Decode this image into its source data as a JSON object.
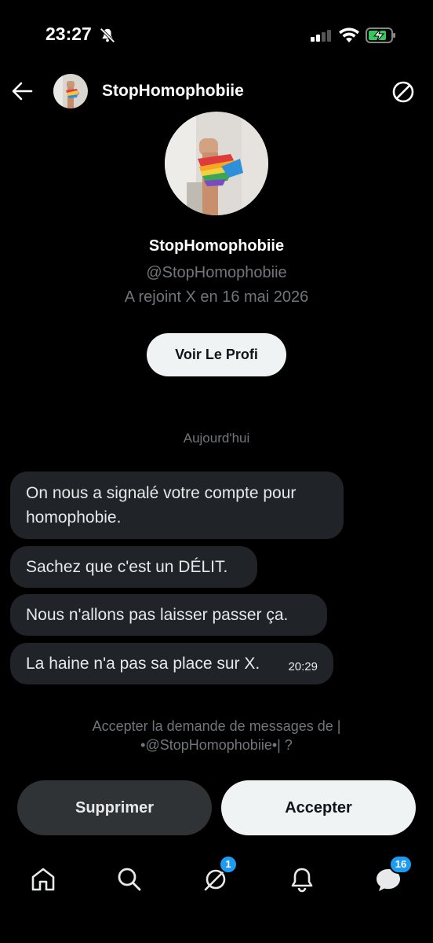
{
  "status": {
    "time": "23:27"
  },
  "header": {
    "name": "StopHomophobiie"
  },
  "profile": {
    "name": "StopHomophobiie",
    "handle": "@StopHomophobiie",
    "joined": "A rejoint X en 16 mai 2026",
    "view_profile_label": "Voir Le Profi"
  },
  "conversation": {
    "date_separator": "Aujourd'hui",
    "messages": [
      {
        "text": "On nous a signalé votre compte pour homophobie."
      },
      {
        "text": "Sachez que c'est un DÉLIT."
      },
      {
        "text": "Nous n'allons pas laisser passer ça."
      },
      {
        "text": "La haine n'a pas sa place sur X.",
        "time": "20:29"
      }
    ]
  },
  "request": {
    "line1": "Accepter la demande de messages de |",
    "line2": "•@StopHomophobiie•| ?",
    "delete_label": "Supprimer",
    "accept_label": "Accepter"
  },
  "nav": {
    "items": [
      {
        "icon": "home-icon"
      },
      {
        "icon": "search-icon"
      },
      {
        "icon": "grok-icon",
        "badge": "1"
      },
      {
        "icon": "notifications-icon"
      },
      {
        "icon": "messages-icon",
        "badge": "16"
      }
    ]
  },
  "colors": {
    "accent": "#1d9bf0",
    "bubble": "#202327",
    "muted": "#71767b"
  }
}
